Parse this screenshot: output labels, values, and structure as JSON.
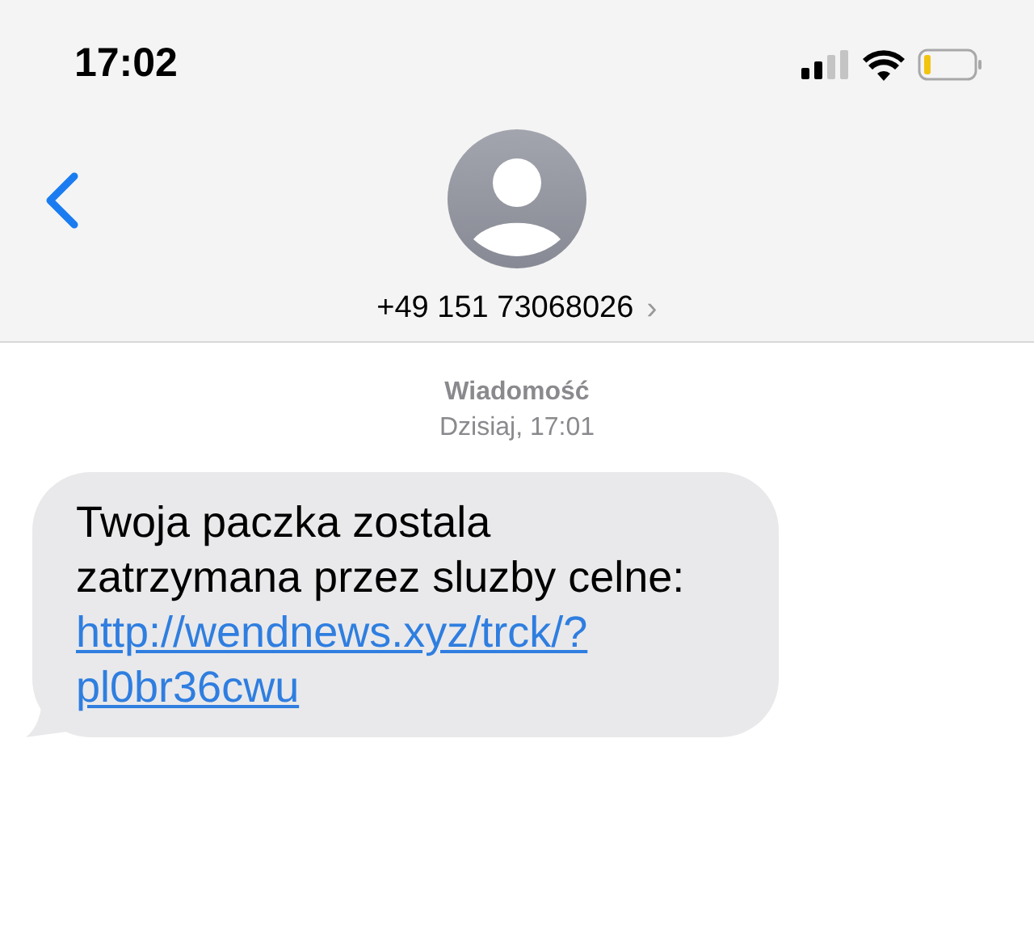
{
  "status_bar": {
    "time": "17:02"
  },
  "header": {
    "contact": "+49 151 73068026",
    "disclosure": "›"
  },
  "thread": {
    "service": "Wiadomość",
    "timestamp": "Dzisiaj, 17:01"
  },
  "messages": [
    {
      "text": "Twoja paczka zostala zatrzymana przez sluzby celne:",
      "link": "http://wendnews.xyz/trck/?pl0br36cwu"
    }
  ]
}
